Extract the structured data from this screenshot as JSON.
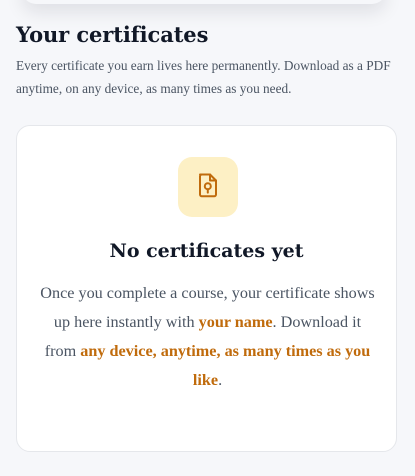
{
  "certificates": {
    "title": "Your certificates",
    "description": "Every certificate you earn lives here permanently. Download as a PDF anytime, on any device, as many times as you need."
  },
  "empty_state": {
    "icon": "certificate-file-icon",
    "accent_color": "#c06b0c",
    "tile_color": "#fdf0c5",
    "title": "No certificates yet",
    "body_part_1": "Once you complete a course, your certificate shows up here instantly with ",
    "highlight_1": "your name",
    "body_part_2": ". Download it from ",
    "highlight_2": "any device, anytime, as many times as you like",
    "body_part_3": "."
  }
}
